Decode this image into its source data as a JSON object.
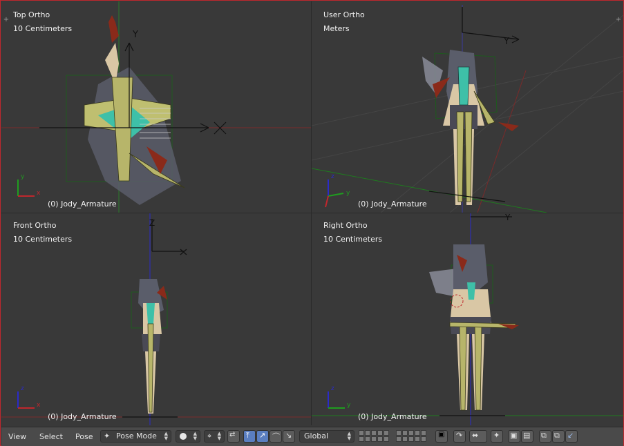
{
  "viewports": [
    {
      "id": "top",
      "view_name": "Top Ortho",
      "scale": "10 Centimeters",
      "object_label": "(0) Jody_Armature",
      "axis_labels": [
        "x",
        "y"
      ]
    },
    {
      "id": "user",
      "view_name": "User Ortho",
      "scale": "Meters",
      "object_label": "(0) Jody_Armature",
      "axis_labels": [
        "x",
        "y",
        "z"
      ]
    },
    {
      "id": "front",
      "view_name": "Front Ortho",
      "scale": "10 Centimeters",
      "object_label": "(0) Jody_Armature",
      "axis_labels": [
        "x",
        "z"
      ]
    },
    {
      "id": "right",
      "view_name": "Right Ortho",
      "scale": "10 Centimeters",
      "object_label": "(0) Jody_Armature",
      "axis_labels": [
        "y",
        "z"
      ]
    }
  ],
  "toolbar": {
    "menus": [
      "View",
      "Select",
      "Pose"
    ],
    "mode": "Pose Mode",
    "orientation": "Global"
  },
  "colors": {
    "axis_x": "#c0272d",
    "axis_y": "#1f9e1f",
    "axis_z": "#2b2bc9",
    "viewport_bg": "#393939",
    "bone": "#c8c878",
    "selected_bone": "#3ec0a8",
    "border": "#c0272d"
  },
  "icons": [
    "pose-mode-icon",
    "shading-solid-icon",
    "pivot-icon",
    "manipulator-icon",
    "translate-icon",
    "rotate-icon",
    "scale-icon",
    "layers-icon",
    "proportional-icon",
    "snap-icon",
    "render-icon",
    "copy-pose-icon",
    "paste-pose-icon",
    "paste-flip-icon"
  ]
}
